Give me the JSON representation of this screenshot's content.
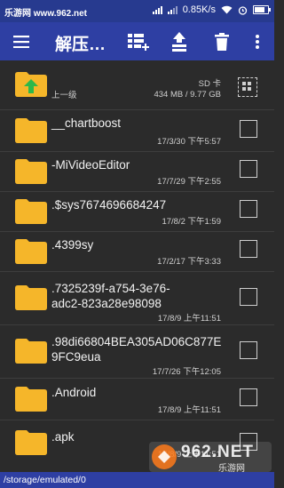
{
  "status": {
    "watermark": "乐游网 www.962.net",
    "speed": "0.85K/s"
  },
  "toolbar": {
    "title": "解压…"
  },
  "parent": {
    "label": "上一级",
    "storage": "SD 卡",
    "space": "434 MB / 9.77 GB"
  },
  "items": [
    {
      "name": "__chartboost",
      "date": "17/3/30 下午5:57"
    },
    {
      "name": "-MiVideoEditor",
      "date": "17/7/29 下午2:55"
    },
    {
      "name": ".$sys7674696684247",
      "date": "17/8/2 下午1:59"
    },
    {
      "name": ".4399sy",
      "date": "17/2/17 下午3:33"
    },
    {
      "name": ".7325239f-a754-3e76-adc2-823a28e98098",
      "line1": ".7325239f-a754-3e76-",
      "line2": "adc2-823a28e98098",
      "date": "17/8/9 上午11:51"
    },
    {
      "name": ".98di66804BEA305AD06C877E9FC9eua",
      "line1": ".98di66804BEA305AD06C877E",
      "line2": "9FC9eua",
      "date": "17/7/26 下午12:05"
    },
    {
      "name": ".Android",
      "date": "17/8/9 上午11:51"
    },
    {
      "name": ".apk",
      "date": "17/8/9 上午11:51"
    }
  ],
  "path": "/storage/emulated/0",
  "watermark2": {
    "text": "962.NET",
    "sub": "乐游网"
  },
  "colors": {
    "toolbar": "#2e3fa3",
    "statusbar": "#273a8f",
    "background": "#2b2b2b",
    "folder": "#f5b62a",
    "arrow": "#2db84a"
  }
}
